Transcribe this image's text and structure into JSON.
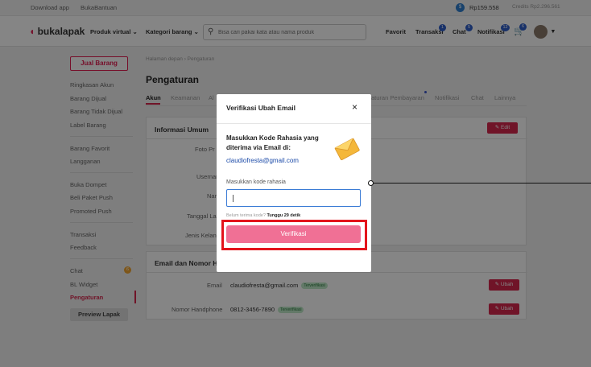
{
  "topbar": {
    "download_app": "Download app",
    "bukabantuan": "BukaBantuan",
    "balance": "Rp159.558",
    "credits": "Credits Rp2.296.561"
  },
  "nav": {
    "logo": "bukalapak",
    "product_virtual": "Produk virtual",
    "kategori": "Kategori barang",
    "search_placeholder": "Bisa cari pakai kata atau nama produk",
    "favorit": "Favorit",
    "transaksi": "Transaksi",
    "transaksi_badge": "1",
    "chat": "Chat",
    "chat_badge": "5",
    "notifikasi": "Notifikasi",
    "notifikasi_badge": "12",
    "cart_badge": "6"
  },
  "sidebar": {
    "jual_barang": "Jual Barang",
    "items": [
      "Ringkasan Akun",
      "Barang Dijual",
      "Barang Tidak Dijual",
      "Label Barang",
      "Barang Favorit",
      "Langganan",
      "Buka Dompet",
      "Beli Paket Push",
      "Promoted Push",
      "Transaksi",
      "Feedback",
      "Chat",
      "BL Widget",
      "Pengaturan"
    ],
    "chat_badge": "6",
    "preview_lapak": "Preview Lapak"
  },
  "main": {
    "breadcrumb": "Halaman depan  ›  Pengaturan",
    "page_title": "Pengaturan",
    "tabs": [
      "Akun",
      "Keamanan",
      "Al",
      "aturan Pembayaran",
      "Notifikasi",
      "Chat",
      "Lainnya"
    ],
    "card1": {
      "title": "Informasi Umum",
      "edit_label": "Edit",
      "labels": [
        "Foto Pr",
        "Usernar",
        "Nar",
        "Tanggal La",
        "Jenis Kelan"
      ]
    },
    "card2": {
      "title": "Email dan Nomor Ha",
      "email_label": "Email",
      "email_value": "claudiofresta@gmail.com",
      "email_status": "Terverifikasi",
      "phone_label": "Nomor Handphone",
      "phone_value": "0812-3456-7890",
      "phone_status": "Terverifikasi",
      "ubah_label": "Ubah"
    }
  },
  "modal": {
    "title": "Verifikasi Ubah Email",
    "close": "×",
    "heading": "Masukkan Kode Rahasia yang diterima via Email di:",
    "email": "claudiofresta@gmail.com",
    "input_label": "Masukkan kode rahasia",
    "resend_prefix": "Belum terima kode?",
    "resend_timer": "Tunggu 29 detik",
    "button": "Verifikasi"
  }
}
